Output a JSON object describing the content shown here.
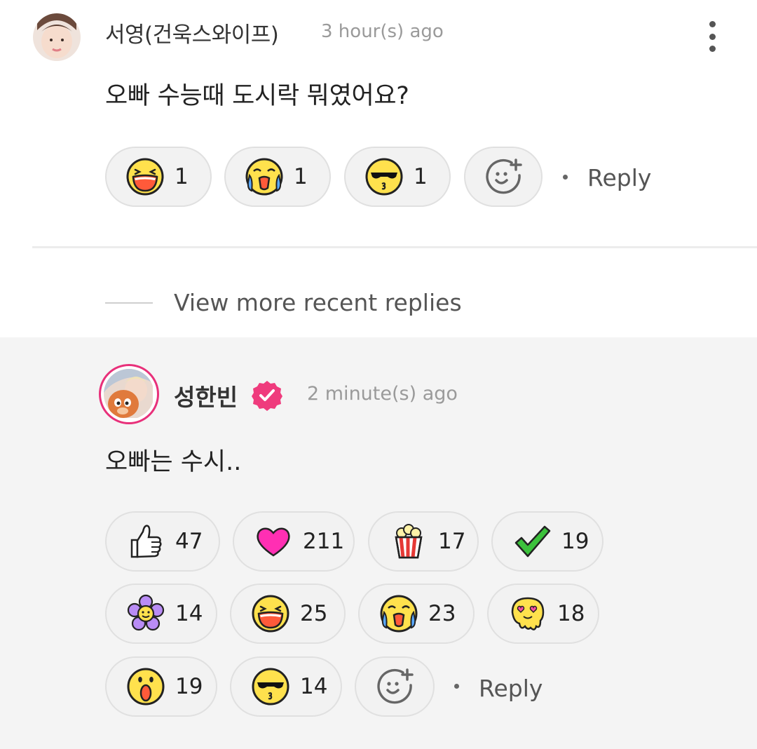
{
  "comment": {
    "author": "서영(건욱스와이프)",
    "time": "3 hour(s) ago",
    "text": "오빠 수능때 도시락 뭐였어요?",
    "reactions": [
      {
        "icon": "laughing-emoji-icon",
        "count": "1"
      },
      {
        "icon": "crying-emoji-icon",
        "count": "1"
      },
      {
        "icon": "sunglasses-kiss-emoji-icon",
        "count": "1"
      }
    ],
    "reply_label": "Reply"
  },
  "view_more_label": "View more recent replies",
  "reply": {
    "author": "성한빈",
    "verified_icon": "verified-badge-icon",
    "time": "2 minute(s) ago",
    "text": "오빠는 수시..",
    "reactions": [
      {
        "icon": "thumbs-up-icon",
        "count": "47"
      },
      {
        "icon": "heart-icon",
        "count": "211"
      },
      {
        "icon": "popcorn-icon",
        "count": "17"
      },
      {
        "icon": "checkmark-icon",
        "count": "19"
      },
      {
        "icon": "flower-icon",
        "count": "14"
      },
      {
        "icon": "laughing-emoji-icon",
        "count": "25"
      },
      {
        "icon": "crying-emoji-icon",
        "count": "23"
      },
      {
        "icon": "melting-heart-eyes-emoji-icon",
        "count": "18"
      },
      {
        "icon": "surprised-emoji-icon",
        "count": "19"
      },
      {
        "icon": "sunglasses-kiss-emoji-icon",
        "count": "14"
      }
    ],
    "reply_label": "Reply"
  },
  "colors": {
    "accent_pink": "#e8307a",
    "pill_bg": "#f2f2f2",
    "reply_bg": "#f4f4f4",
    "emoji_yellow": "#ffe14d",
    "heart_pink": "#ff2fb3"
  }
}
